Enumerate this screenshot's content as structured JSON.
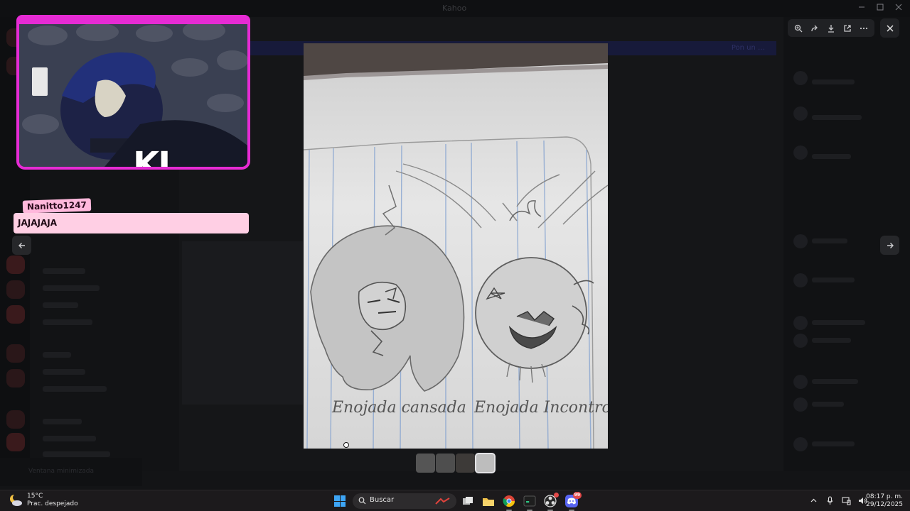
{
  "background_app": {
    "window_title": "Kahoo",
    "banner_text": "Pon un …",
    "user_status": "Ventana minimizada"
  },
  "viewer": {
    "toolbar": {
      "zoom": "zoom-icon",
      "forward": "forward-icon",
      "download": "download-icon",
      "open_external": "open-external-icon",
      "more": "more-icon"
    },
    "close": "close-icon",
    "prev": "arrow-left-icon",
    "next": "arrow-right-icon",
    "thumbnail_count": 4,
    "active_thumbnail": 4
  },
  "drawing": {
    "left_caption": "Enojada cansada",
    "right_caption": "Enojada Incontrolable"
  },
  "webcam": {
    "tag": "KJ",
    "frame_color": "#e62bd4"
  },
  "chat_overlay": {
    "username": "Nanitto1247",
    "message": "JAJAJAJA",
    "bubble_color": "#ffcfe4"
  },
  "taskbar": {
    "weather_temp": "15°C",
    "weather_desc": "Prac. despejado",
    "search_placeholder": "Buscar",
    "discord_badge": "99",
    "time": "08:17 p. m.",
    "date": "29/12/2025"
  }
}
